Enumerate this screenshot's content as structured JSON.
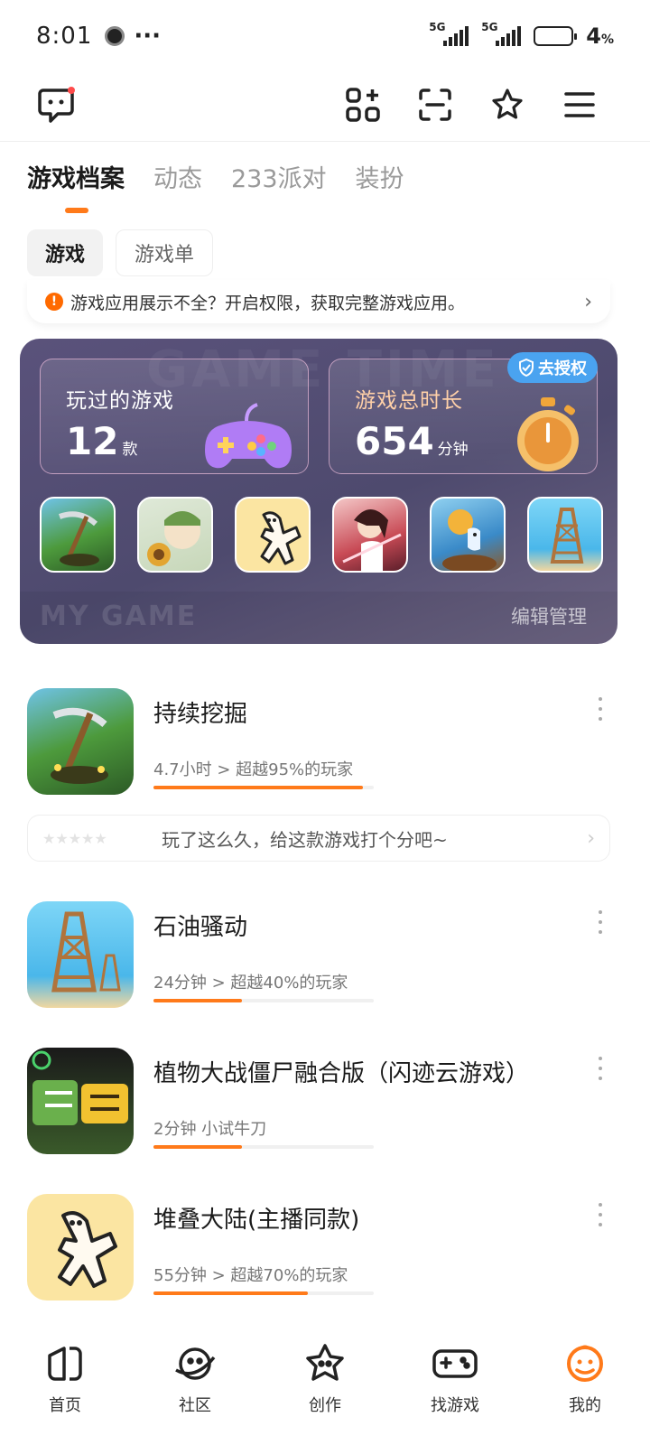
{
  "status_bar": {
    "time": "8:01",
    "ellipsis": "···",
    "signal1": "5G",
    "signal2": "5G",
    "battery": "4",
    "battery_unit": "%"
  },
  "tabs": [
    {
      "label": "游戏档案",
      "active": true
    },
    {
      "label": "动态",
      "active": false
    },
    {
      "label": "233派对",
      "active": false
    },
    {
      "label": "装扮",
      "active": false
    }
  ],
  "chips": [
    {
      "label": "游戏",
      "active": true
    },
    {
      "label": "游戏单",
      "active": false
    }
  ],
  "notice": {
    "icon": "!",
    "text": "游戏应用展示不全？开启权限，获取完整游戏应用。",
    "arrow": "›"
  },
  "stats_card": {
    "played": {
      "label": "玩过的游戏",
      "value": "12",
      "unit": "款"
    },
    "duration": {
      "label": "游戏总时长",
      "value": "654",
      "unit": "分钟"
    },
    "authorize_label": "去授权",
    "bg_word_top": "GAME TIME",
    "footer_title": "MY GAME",
    "edit_label": "编辑管理"
  },
  "games": [
    {
      "title": "持续挖掘",
      "meta": "4.7小时 > 超越95%的玩家",
      "progress": 0.95
    },
    {
      "title": "石油骚动",
      "meta": "24分钟 > 超越40%的玩家",
      "progress": 0.4
    },
    {
      "title": "植物大战僵尸融合版（闪迹云游戏）",
      "meta": "2分钟 小试牛刀",
      "progress": 0.4
    },
    {
      "title": "堆叠大陆(主播同款)",
      "meta": "55分钟 > 超越70%的玩家",
      "progress": 0.7
    }
  ],
  "rating": {
    "stars": "★★★★★",
    "text": "玩了这么久，给这款游戏打个分吧~",
    "arrow": "›"
  },
  "bottom_nav": [
    {
      "label": "首页"
    },
    {
      "label": "社区"
    },
    {
      "label": "创作"
    },
    {
      "label": "找游戏"
    },
    {
      "label": "我的"
    }
  ],
  "colors": {
    "accent": "#ff7a1a",
    "card_bg": "#534d73",
    "badge": "#4aa3f0"
  }
}
